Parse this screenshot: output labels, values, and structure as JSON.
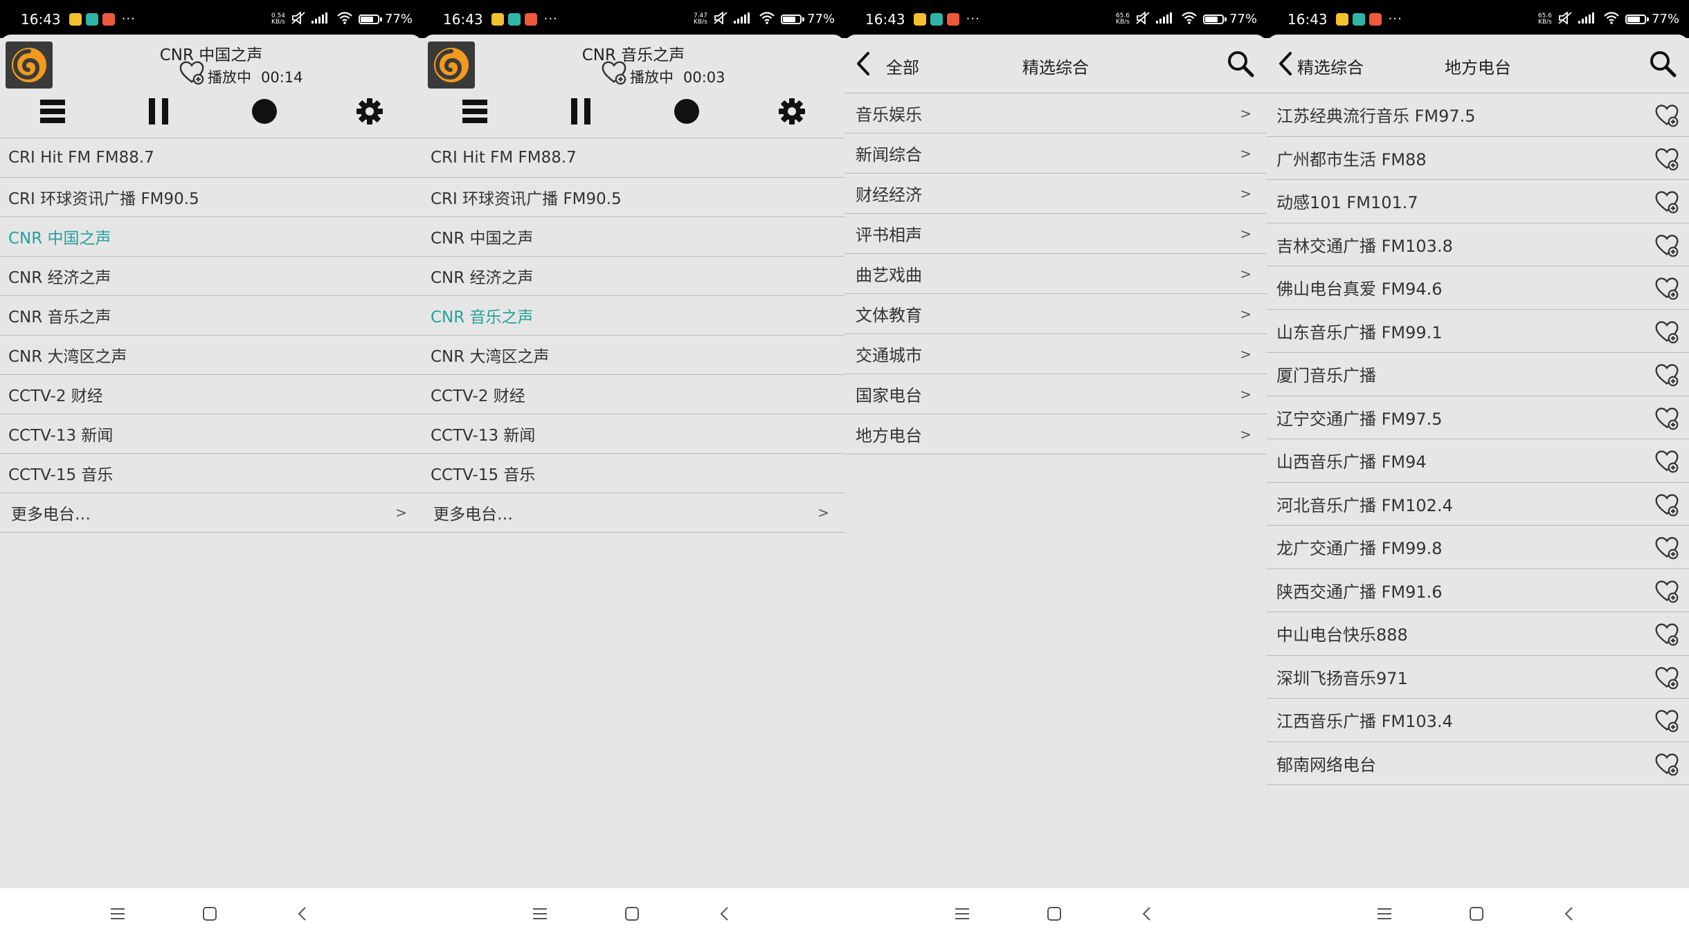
{
  "status_bar": {
    "time": "16:43",
    "battery": "77%",
    "battery_level": 0.77,
    "speeds": [
      [
        "0.54",
        "KB/s"
      ],
      [
        "7.47",
        "KB/s"
      ],
      [
        "65.6",
        "KB/s"
      ],
      [
        "65.6",
        "KB/s"
      ]
    ],
    "app_icon_colors": [
      "#f2c12e",
      "#2fb5a5",
      "#f05a3c"
    ],
    "dots": "···"
  },
  "screens": [
    {
      "type": "player",
      "station_title": "CNR 中国之声",
      "status_label": "播放中",
      "elapsed": "00:14",
      "stations": [
        "CRI Hit FM FM88.7",
        "CRI 环球资讯广播 FM90.5",
        "CNR 中国之声",
        "CNR 经济之声",
        "CNR 音乐之声",
        "CNR 大湾区之声",
        "CCTV-2 财经",
        "CCTV-13 新闻",
        "CCTV-15 音乐"
      ],
      "active_index": 2,
      "more_label": "更多电台…",
      "more_chevron": ">"
    },
    {
      "type": "player",
      "station_title": "CNR 音乐之声",
      "status_label": "播放中",
      "elapsed": "00:03",
      "stations": [
        "CRI Hit FM FM88.7",
        "CRI 环球资讯广播 FM90.5",
        "CNR 中国之声",
        "CNR 经济之声",
        "CNR 音乐之声",
        "CNR 大湾区之声",
        "CCTV-2 财经",
        "CCTV-13 新闻",
        "CCTV-15 音乐"
      ],
      "active_index": 4,
      "more_label": "更多电台…",
      "more_chevron": ">"
    },
    {
      "type": "categories",
      "back_label": "全部",
      "title": "精选综合",
      "chevron": ">",
      "categories": [
        "音乐娱乐",
        "新闻综合",
        "财经经济",
        "评书相声",
        "曲艺戏曲",
        "文体教育",
        "交通城市",
        "国家电台",
        "地方电台"
      ]
    },
    {
      "type": "local",
      "back_label": "精选综合",
      "title": "地方电台",
      "stations": [
        "江苏经典流行音乐 FM97.5",
        "广州都市生活 FM88",
        "动感101 FM101.7",
        "吉林交通广播 FM103.8",
        "佛山电台真爱 FM94.6",
        "山东音乐广播 FM99.1",
        "厦门音乐广播",
        "辽宁交通广播 FM97.5",
        "山西音乐广播 FM94",
        "河北音乐广播 FM102.4",
        "龙广交通广播 FM99.8",
        "陕西交通广播 FM91.6",
        "中山电台快乐888",
        "深圳飞扬音乐971",
        "江西音乐广播 FM103.4",
        "郁南网络电台"
      ]
    }
  ],
  "colors": {
    "accent": "#23a29a",
    "logo_orange": "#f29a1d",
    "background": "#e6e6e6",
    "divider": "#b8b8b8"
  }
}
